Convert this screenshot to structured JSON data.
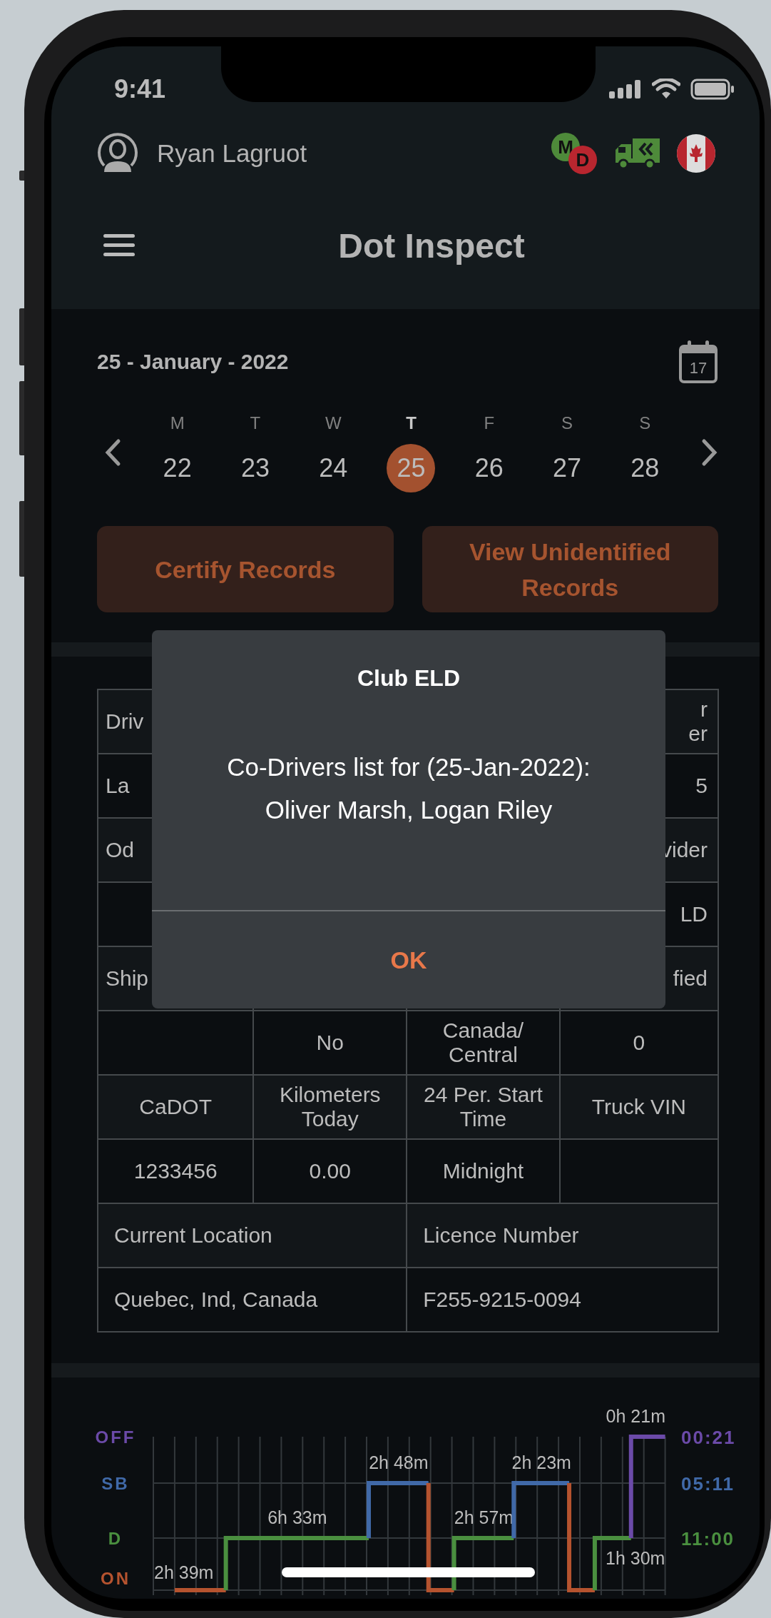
{
  "status_bar": {
    "time": "9:41"
  },
  "header": {
    "user_name": "Ryan Lagruot",
    "md_badge": {
      "primary": "M",
      "secondary": "D"
    },
    "title": "Dot Inspect"
  },
  "date_picker": {
    "date_label": "25 - January - 2022",
    "calendar_icon_day": "17",
    "days": [
      {
        "weekday": "M",
        "day": "22",
        "selected": false
      },
      {
        "weekday": "T",
        "day": "23",
        "selected": false
      },
      {
        "weekday": "W",
        "day": "24",
        "selected": false
      },
      {
        "weekday": "T",
        "day": "25",
        "selected": true
      },
      {
        "weekday": "F",
        "day": "26",
        "selected": false
      },
      {
        "weekday": "S",
        "day": "27",
        "selected": false
      },
      {
        "weekday": "S",
        "day": "28",
        "selected": false
      }
    ]
  },
  "actions": [
    "Certify Records",
    "View Unidentified Records"
  ],
  "table": {
    "rows": [
      {
        "kind": "partial",
        "cells": [
          "Driv",
          null,
          null,
          "r\ner"
        ]
      },
      {
        "kind": "partial",
        "cells": [
          "La",
          null,
          null,
          "5"
        ]
      },
      {
        "kind": "partial",
        "cells": [
          "Od",
          null,
          null,
          "vider"
        ]
      },
      {
        "kind": "partial",
        "cells": [
          null,
          null,
          null,
          "LD"
        ]
      },
      {
        "kind": "partial",
        "cells": [
          "Ship",
          null,
          null,
          "fied"
        ]
      },
      {
        "kind": "full",
        "cells": [
          null,
          "No",
          "Canada/Central",
          "0"
        ]
      },
      {
        "kind": "full",
        "cells": [
          "CaDOT",
          "Kilometers Today",
          "24 Per. Start Time",
          "Truck VIN"
        ]
      },
      {
        "kind": "full",
        "cells": [
          "1233456",
          "0.00",
          "Midnight",
          null
        ]
      },
      {
        "kind": "wide",
        "cells": [
          {
            "text": "Current Location",
            "colspan": 2
          },
          {
            "text": "Licence Number",
            "colspan": 2
          }
        ]
      },
      {
        "kind": "wide",
        "cells": [
          {
            "text": "Quebec, Ind, Canada",
            "colspan": 2
          },
          {
            "text": "F255-9215-0094",
            "colspan": 2
          }
        ]
      }
    ]
  },
  "log_graph": {
    "rows": [
      {
        "kind": "off",
        "label": "OFF",
        "total": "00:21",
        "color": "#6b4aa8"
      },
      {
        "kind": "sb",
        "label": "SB",
        "total": "05:11",
        "color": "#4069a8"
      },
      {
        "kind": "d",
        "label": "D",
        "total": "11:00",
        "color": "#4a8f3f"
      },
      {
        "kind": "on",
        "label": "ON",
        "color": "#b5532f"
      }
    ],
    "segments": [
      {
        "kind": "on",
        "label": "2h 39m"
      },
      {
        "kind": "d",
        "label": "6h 33m"
      },
      {
        "kind": "sb",
        "label": "2h 48m"
      },
      {
        "kind": "on"
      },
      {
        "kind": "d",
        "label": "2h 57m"
      },
      {
        "kind": "sb",
        "label": "2h 23m"
      },
      {
        "kind": "on"
      },
      {
        "kind": "d",
        "label": "1h 30m"
      },
      {
        "kind": "off",
        "label": "0h 21m"
      }
    ]
  },
  "dialog": {
    "title": "Club ELD",
    "message": "Co-Drivers list for (25-Jan-2022):\nOliver Marsh, Logan Riley",
    "button": "OK"
  }
}
